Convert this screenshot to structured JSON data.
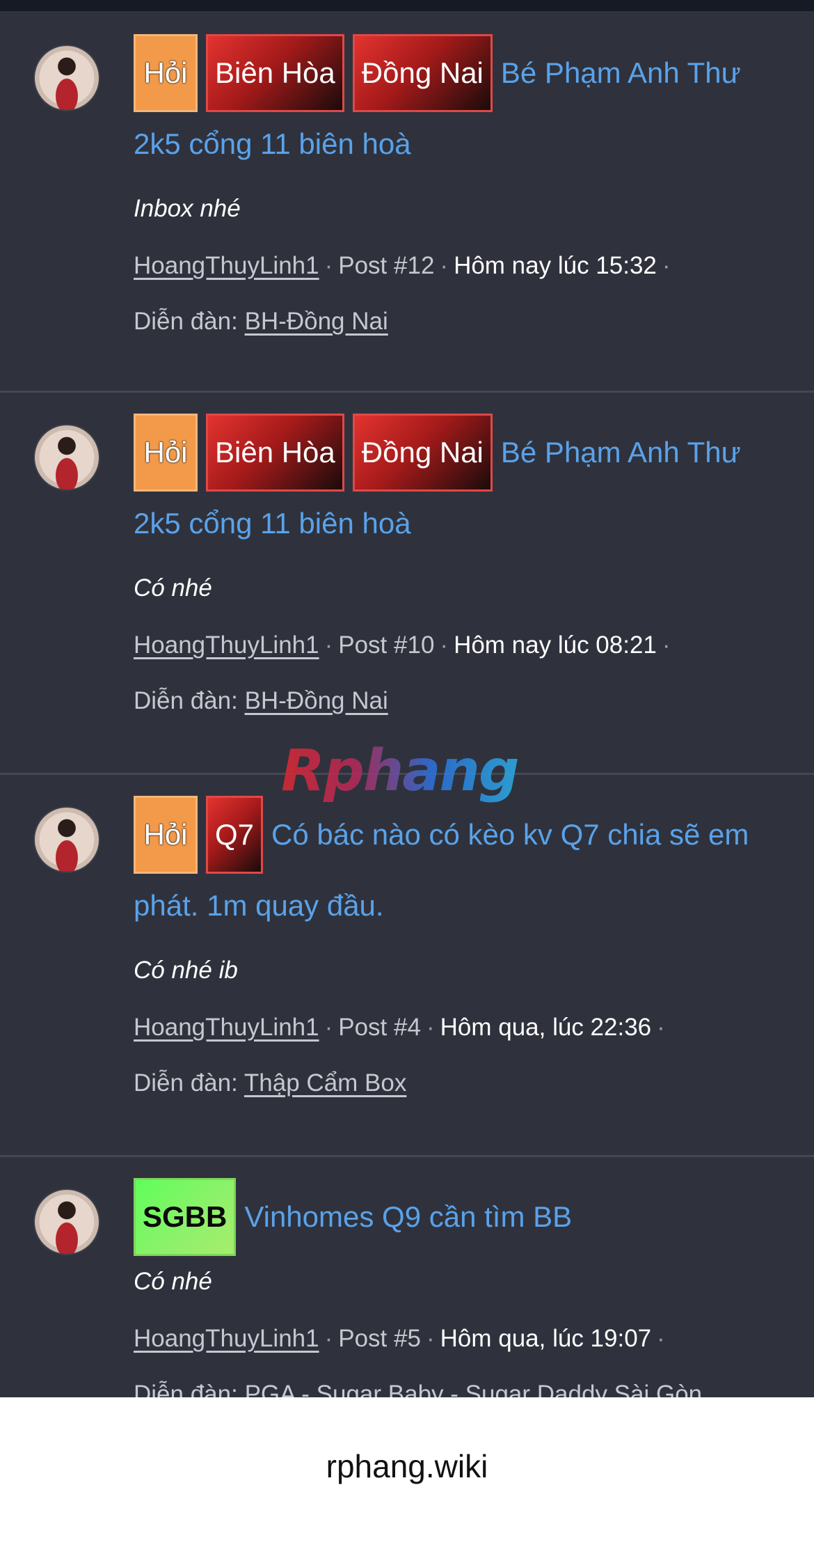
{
  "posts": [
    {
      "prefixes": [
        "Hỏi",
        "Biên Hòa",
        "Đồng Nai"
      ],
      "title_line1": "Bé Phạm Anh Thư",
      "title_line2": "2k5 cổng 11 biên hoà",
      "snippet": "Inbox nhé",
      "user": "HoangThuyLinh1",
      "post_no": "Post #12",
      "time": "Hôm nay lúc 15:32",
      "forum_label": "Diễn đàn:",
      "forum": "BH-Đồng Nai"
    },
    {
      "prefixes": [
        "Hỏi",
        "Biên Hòa",
        "Đồng Nai"
      ],
      "title_line1": "Bé Phạm Anh Thư",
      "title_line2": "2k5 cổng 11 biên hoà",
      "snippet": "Có nhé",
      "user": "HoangThuyLinh1",
      "post_no": "Post #10",
      "time": "Hôm nay lúc 08:21",
      "forum_label": "Diễn đàn:",
      "forum": "BH-Đồng Nai"
    },
    {
      "prefixes": [
        "Hỏi",
        "Q7"
      ],
      "title_line1": "Có bác nào có kèo kv Q7 chia sẽ em",
      "title_line2": "phát. 1m quay đầu.",
      "snippet": "Có nhé ib",
      "user": "HoangThuyLinh1",
      "post_no": "Post #4",
      "time": "Hôm qua, lúc 22:36",
      "forum_label": "Diễn đàn:",
      "forum": "Thập Cẩm Box"
    },
    {
      "prefixes": [
        "SGBB"
      ],
      "title_line1": "Vinhomes Q9 cần tìm BB",
      "title_line2": "",
      "snippet": "Có nhé",
      "user": "HoangThuyLinh1",
      "post_no": "Post #5",
      "time": "Hôm qua, lúc 19:07",
      "forum_label": "Diễn đàn:",
      "forum": "PGA - Sugar Baby - Sugar Daddy Sài Gòn"
    }
  ],
  "separator": "·",
  "watermark": "Rphang",
  "footer": {
    "domain": "rphang.wiki"
  },
  "colors": {
    "background": "#2f323c",
    "link": "#5aa2ea",
    "prefix_hoi": "#f29a49",
    "prefix_red": "#c0262a",
    "prefix_green": "#6af55e"
  }
}
